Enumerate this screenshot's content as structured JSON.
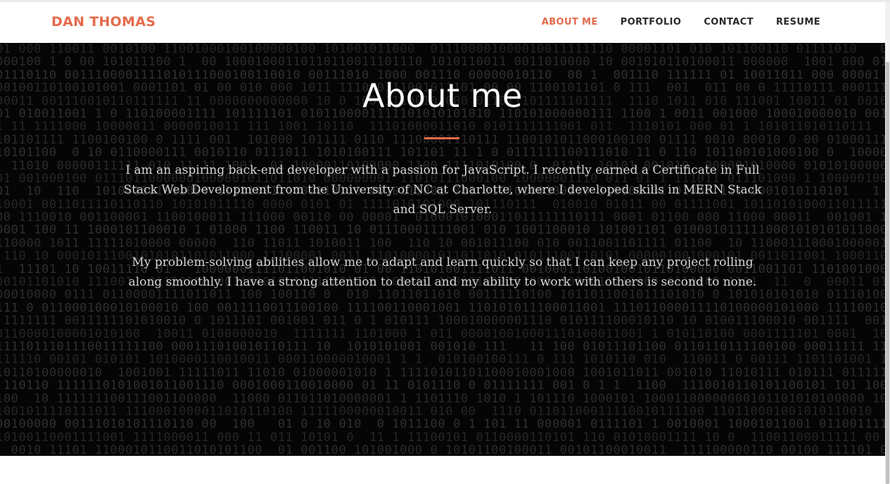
{
  "brand": {
    "name": "DAN THOMAS"
  },
  "nav": {
    "items": [
      {
        "label": "ABOUT ME",
        "active": true
      },
      {
        "label": "PORTFOLIO",
        "active": false
      },
      {
        "label": "CONTACT",
        "active": false
      },
      {
        "label": "RESUME",
        "active": false
      }
    ]
  },
  "hero": {
    "title": "About me",
    "paragraphs": [
      "I am an aspiring back-end developer with a passion for JavaScript. I recently earned a Certificate in Full Stack Web Development from the University of NC at Charlotte, where I developed skills in MERN Stack and SQL Server.",
      "My problem-solving abilities allow me to adapt and learn quickly so that I can keep any project rolling along smoothly. I have a strong attention to detail and my ability to work with others is second to none."
    ]
  },
  "colors": {
    "accent": "#e56a4b",
    "hero_background": "#050505",
    "hero_text": "#d6d6d6",
    "nav_text": "#2a2a2a"
  },
  "icons": {
    "background": "binary-code-pattern"
  }
}
